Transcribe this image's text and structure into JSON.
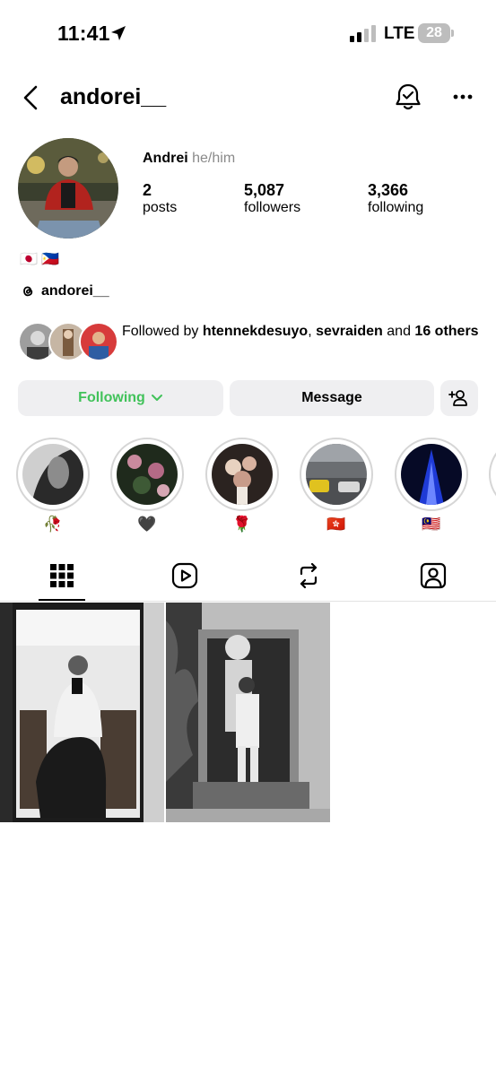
{
  "status_bar": {
    "time": "11:41",
    "network": "LTE",
    "battery": "28"
  },
  "header": {
    "username": "andorei__"
  },
  "profile": {
    "display_name": "Andrei",
    "pronouns": "he/him",
    "stats": [
      {
        "number": "2",
        "label": "posts"
      },
      {
        "number": "5,087",
        "label": "followers"
      },
      {
        "number": "3,366",
        "label": "following"
      }
    ],
    "bio_flags": "🇯🇵 🇵🇭",
    "threads_handle": "andorei__",
    "followed_by": {
      "prefix": "Followed by",
      "name1": "htennekdesuyo",
      "sep": ",",
      "name2": "sevraiden",
      "middle": "and",
      "count": "16 others"
    }
  },
  "buttons": {
    "following": "Following",
    "message": "Message"
  },
  "highlights": [
    {
      "label": "🥀"
    },
    {
      "label": "🖤"
    },
    {
      "label": "🌹"
    },
    {
      "label": "🇭🇰"
    },
    {
      "label": "🇲🇾"
    }
  ],
  "tabs": [
    {
      "icon": "grid-icon",
      "active": true
    },
    {
      "icon": "reels-icon",
      "active": false
    },
    {
      "icon": "reposts-icon",
      "active": false
    },
    {
      "icon": "tagged-icon",
      "active": false
    }
  ],
  "colors": {
    "following_green": "#41c25a",
    "button_bg": "#efeff1",
    "muted": "#8a8a8a"
  }
}
